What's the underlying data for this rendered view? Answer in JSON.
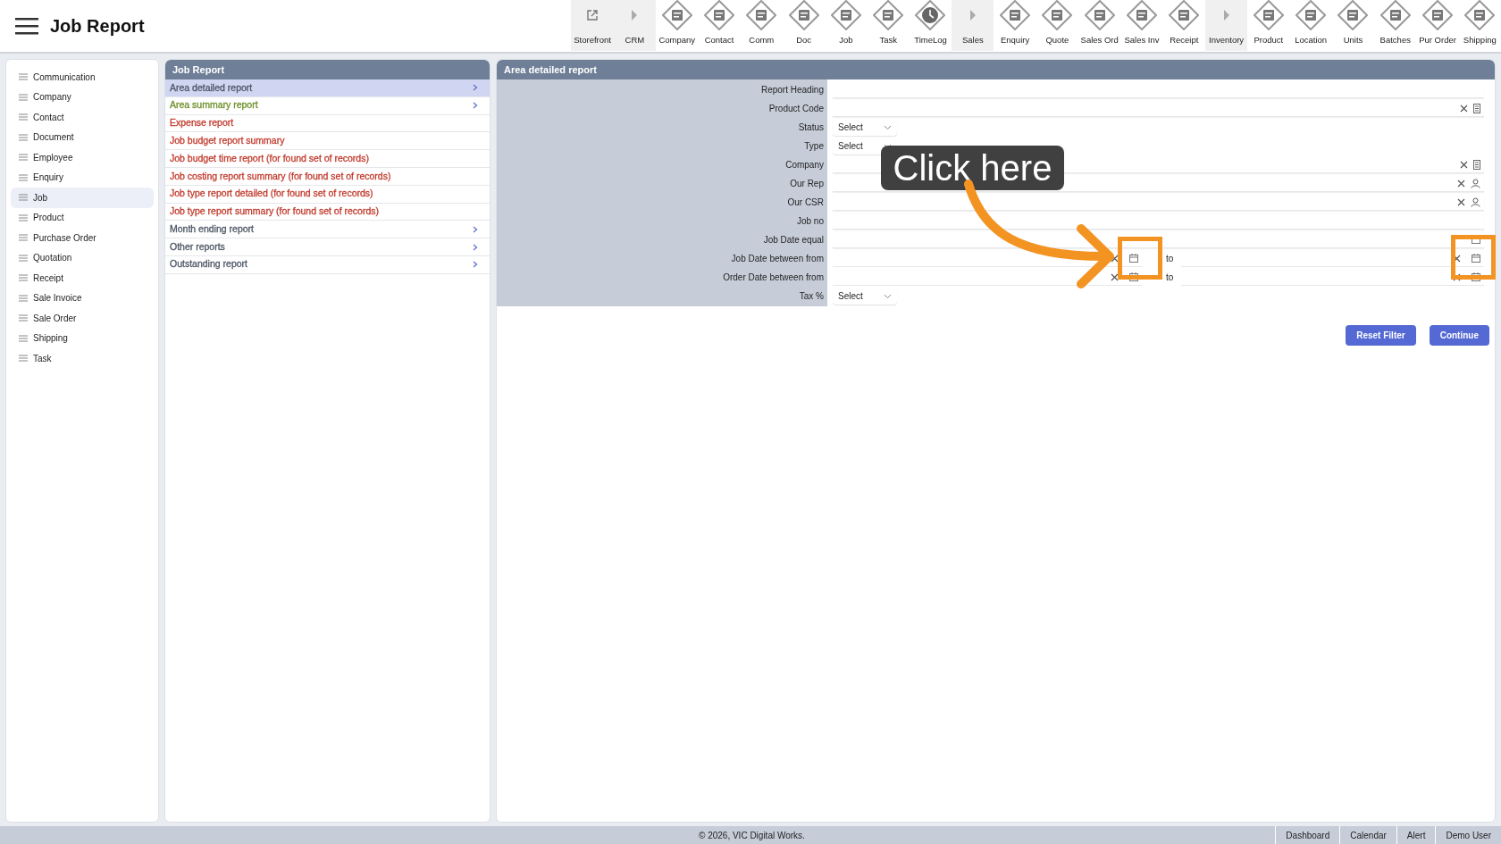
{
  "header": {
    "title": "Job Report"
  },
  "toolbar": [
    {
      "label": "Storefront",
      "kind": "link",
      "shaded": true
    },
    {
      "label": "CRM",
      "kind": "group",
      "shaded": true
    },
    {
      "label": "Company",
      "kind": "module",
      "shaded": false
    },
    {
      "label": "Contact",
      "kind": "module",
      "shaded": false
    },
    {
      "label": "Comm",
      "kind": "module",
      "shaded": false
    },
    {
      "label": "Doc",
      "kind": "module",
      "shaded": false
    },
    {
      "label": "Job",
      "kind": "module",
      "shaded": false
    },
    {
      "label": "Task",
      "kind": "module",
      "shaded": false
    },
    {
      "label": "TimeLog",
      "kind": "clock",
      "shaded": false
    },
    {
      "label": "Sales",
      "kind": "group",
      "shaded": true
    },
    {
      "label": "Enquiry",
      "kind": "module",
      "shaded": false
    },
    {
      "label": "Quote",
      "kind": "module",
      "shaded": false
    },
    {
      "label": "Sales Ord",
      "kind": "module",
      "shaded": false
    },
    {
      "label": "Sales Inv",
      "kind": "module",
      "shaded": false
    },
    {
      "label": "Receipt",
      "kind": "module",
      "shaded": false
    },
    {
      "label": "Inventory",
      "kind": "group",
      "shaded": true
    },
    {
      "label": "Product",
      "kind": "module",
      "shaded": false
    },
    {
      "label": "Location",
      "kind": "module",
      "shaded": false
    },
    {
      "label": "Units",
      "kind": "module",
      "shaded": false
    },
    {
      "label": "Batches",
      "kind": "module",
      "shaded": false
    },
    {
      "label": "Pur Order",
      "kind": "module",
      "shaded": false
    },
    {
      "label": "Shipping",
      "kind": "module",
      "shaded": false
    }
  ],
  "sidebar": {
    "items": [
      {
        "label": "Communication",
        "selected": false
      },
      {
        "label": "Company",
        "selected": false
      },
      {
        "label": "Contact",
        "selected": false
      },
      {
        "label": "Document",
        "selected": false
      },
      {
        "label": "Employee",
        "selected": false
      },
      {
        "label": "Enquiry",
        "selected": false
      },
      {
        "label": "Job",
        "selected": true
      },
      {
        "label": "Product",
        "selected": false
      },
      {
        "label": "Purchase Order",
        "selected": false
      },
      {
        "label": "Quotation",
        "selected": false
      },
      {
        "label": "Receipt",
        "selected": false
      },
      {
        "label": "Sale Invoice",
        "selected": false
      },
      {
        "label": "Sale Order",
        "selected": false
      },
      {
        "label": "Shipping",
        "selected": false
      },
      {
        "label": "Task",
        "selected": false
      }
    ]
  },
  "report_list": {
    "title": "Job Report",
    "items": [
      {
        "label": "Area detailed report",
        "selected": true,
        "color": "#4b5563",
        "submenu": true
      },
      {
        "label": "Area summary report",
        "selected": false,
        "color": "#6b8e23",
        "submenu": true
      },
      {
        "label": "Expense report",
        "selected": false,
        "color": "#c0392b",
        "submenu": false
      },
      {
        "label": "Job budget report summary",
        "selected": false,
        "color": "#c0392b",
        "submenu": false
      },
      {
        "label": "Job budget time report (for found set of records)",
        "selected": false,
        "color": "#c0392b",
        "submenu": false
      },
      {
        "label": "Job costing report summary (for found set of records)",
        "selected": false,
        "color": "#c0392b",
        "submenu": false
      },
      {
        "label": "Job type report detailed (for found set of records)",
        "selected": false,
        "color": "#c0392b",
        "submenu": false
      },
      {
        "label": "Job type report summary (for found set of records)",
        "selected": false,
        "color": "#c0392b",
        "submenu": false
      },
      {
        "label": "Month ending report",
        "selected": false,
        "color": "#4b5563",
        "submenu": true
      },
      {
        "label": "Other reports",
        "selected": false,
        "color": "#4b5563",
        "submenu": true
      },
      {
        "label": "Outstanding report",
        "selected": false,
        "color": "#4b5563",
        "submenu": true
      }
    ]
  },
  "form": {
    "title": "Area detailed report",
    "fields": [
      {
        "label": "Report Heading",
        "kind": "text"
      },
      {
        "label": "Product Code",
        "kind": "lookup_item"
      },
      {
        "label": "Status",
        "kind": "select",
        "value": "Select"
      },
      {
        "label": "Type",
        "kind": "select",
        "value": "Select"
      },
      {
        "label": "Company",
        "kind": "lookup_item"
      },
      {
        "label": "Our Rep",
        "kind": "lookup_person"
      },
      {
        "label": "Our CSR",
        "kind": "lookup_person"
      },
      {
        "label": "Job no",
        "kind": "text"
      },
      {
        "label": "Job Date equal",
        "kind": "date"
      },
      {
        "label": "Job Date between from",
        "kind": "date_range",
        "separator": "to"
      },
      {
        "label": "Order Date between from",
        "kind": "date_range",
        "separator": "to"
      },
      {
        "label": "Tax %",
        "kind": "select",
        "value": "Select"
      }
    ],
    "buttons": [
      "Reset Filter",
      "Continue"
    ]
  },
  "callout": {
    "text": "Click here"
  },
  "footer": {
    "copyright": "© 2026, VIC Digital Works.",
    "links": [
      "Dashboard",
      "Calendar",
      "Alert",
      "Demo User"
    ]
  }
}
